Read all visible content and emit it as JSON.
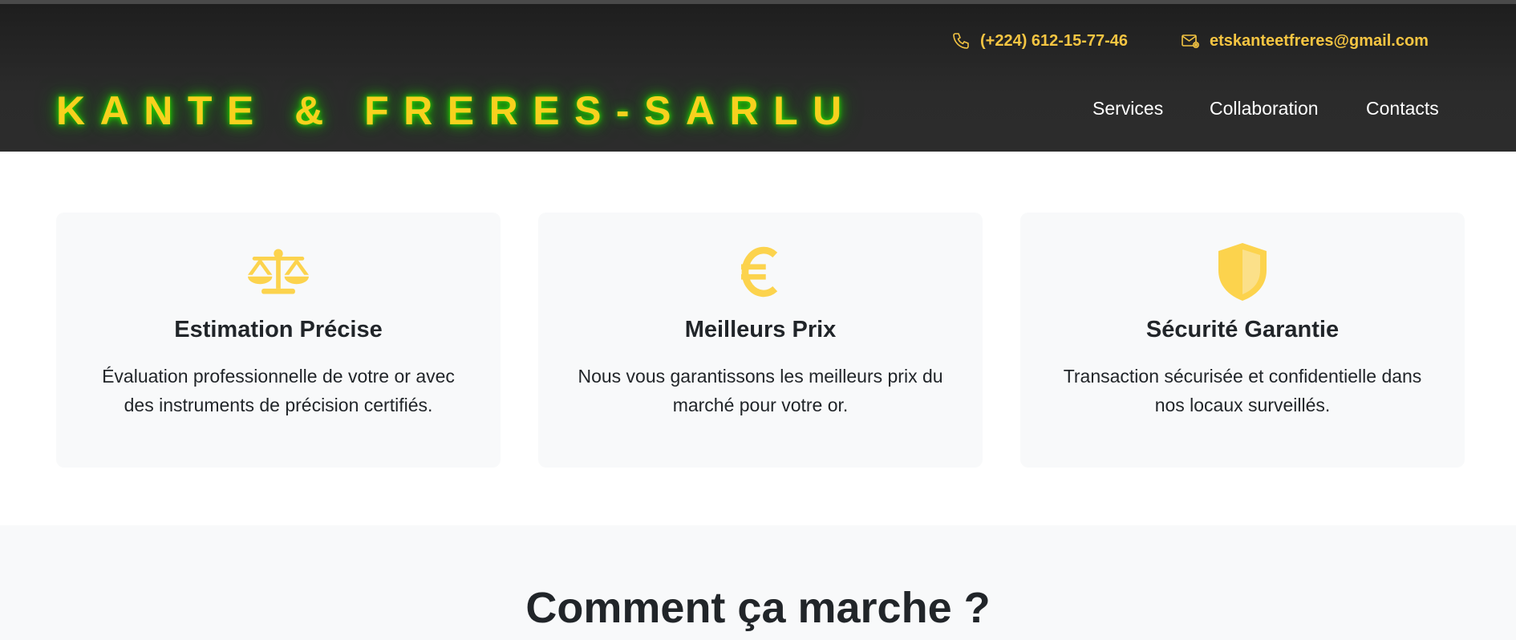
{
  "header": {
    "phone": "(+224) 612-15-77-46",
    "email": "etskanteetfreres@gmail.com",
    "brand": "KANTE & FRERES-SARLU",
    "nav": {
      "services": "Services",
      "collaboration": "Collaboration",
      "contacts": "Contacts"
    },
    "icons": {
      "phone": "phone-icon",
      "email": "envelope-icon"
    }
  },
  "features": [
    {
      "icon": "scale-icon",
      "title": "Estimation Précise",
      "text": "Évaluation professionnelle de votre or avec des instruments de précision certifiés."
    },
    {
      "icon": "euro-icon",
      "title": "Meilleurs Prix",
      "text": "Nous vous garantissons les meilleurs prix du marché pour votre or."
    },
    {
      "icon": "shield-icon",
      "title": "Sécurité Garantie",
      "text": "Transaction sécurisée et confidentielle dans nos locaux surveillés."
    }
  ],
  "how": {
    "title": "Comment ça marche ?"
  },
  "colors": {
    "accent": "#f5c542",
    "brand": "#f7d11e",
    "glow": "#22dd00",
    "header_bg": "#2b2b2b",
    "card_bg": "#f8f9fa",
    "icon": "#fcd34d"
  }
}
